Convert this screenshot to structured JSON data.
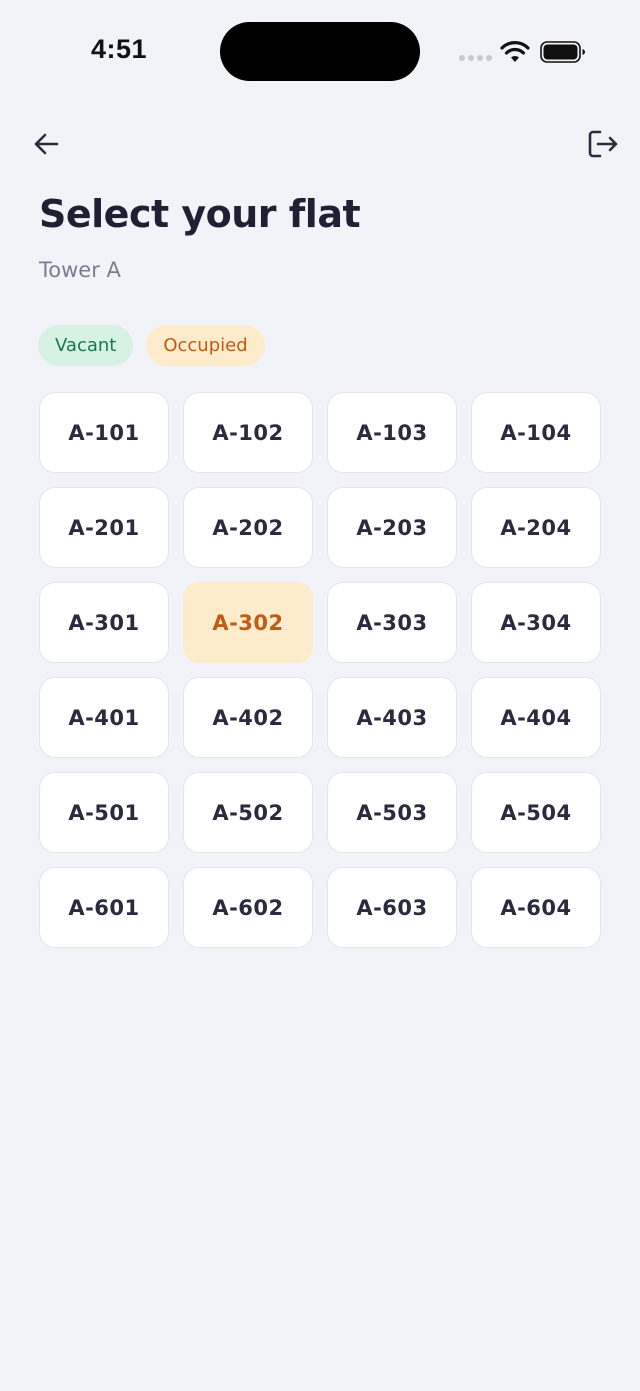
{
  "status_bar": {
    "time": "4:51"
  },
  "nav": {
    "back_icon": "arrow-left-icon",
    "logout_icon": "logout-icon"
  },
  "header": {
    "title": "Select your flat",
    "subtitle": "Tower A"
  },
  "legend": {
    "vacant_label": "Vacant",
    "occupied_label": "Occupied"
  },
  "colors": {
    "background": "#f2f3f9",
    "vacant_bg": "#d6f2e2",
    "vacant_text": "#177a4c",
    "occupied_bg": "#fdebcc",
    "occupied_text": "#c15b12",
    "card_bg": "#ffffff"
  },
  "flats": [
    {
      "label": "A-101",
      "status": "vacant"
    },
    {
      "label": "A-102",
      "status": "vacant"
    },
    {
      "label": "A-103",
      "status": "vacant"
    },
    {
      "label": "A-104",
      "status": "vacant"
    },
    {
      "label": "A-201",
      "status": "vacant"
    },
    {
      "label": "A-202",
      "status": "vacant"
    },
    {
      "label": "A-203",
      "status": "vacant"
    },
    {
      "label": "A-204",
      "status": "vacant"
    },
    {
      "label": "A-301",
      "status": "vacant"
    },
    {
      "label": "A-302",
      "status": "occupied"
    },
    {
      "label": "A-303",
      "status": "vacant"
    },
    {
      "label": "A-304",
      "status": "vacant"
    },
    {
      "label": "A-401",
      "status": "vacant"
    },
    {
      "label": "A-402",
      "status": "vacant"
    },
    {
      "label": "A-403",
      "status": "vacant"
    },
    {
      "label": "A-404",
      "status": "vacant"
    },
    {
      "label": "A-501",
      "status": "vacant"
    },
    {
      "label": "A-502",
      "status": "vacant"
    },
    {
      "label": "A-503",
      "status": "vacant"
    },
    {
      "label": "A-504",
      "status": "vacant"
    },
    {
      "label": "A-601",
      "status": "vacant"
    },
    {
      "label": "A-602",
      "status": "vacant"
    },
    {
      "label": "A-603",
      "status": "vacant"
    },
    {
      "label": "A-604",
      "status": "vacant"
    }
  ]
}
